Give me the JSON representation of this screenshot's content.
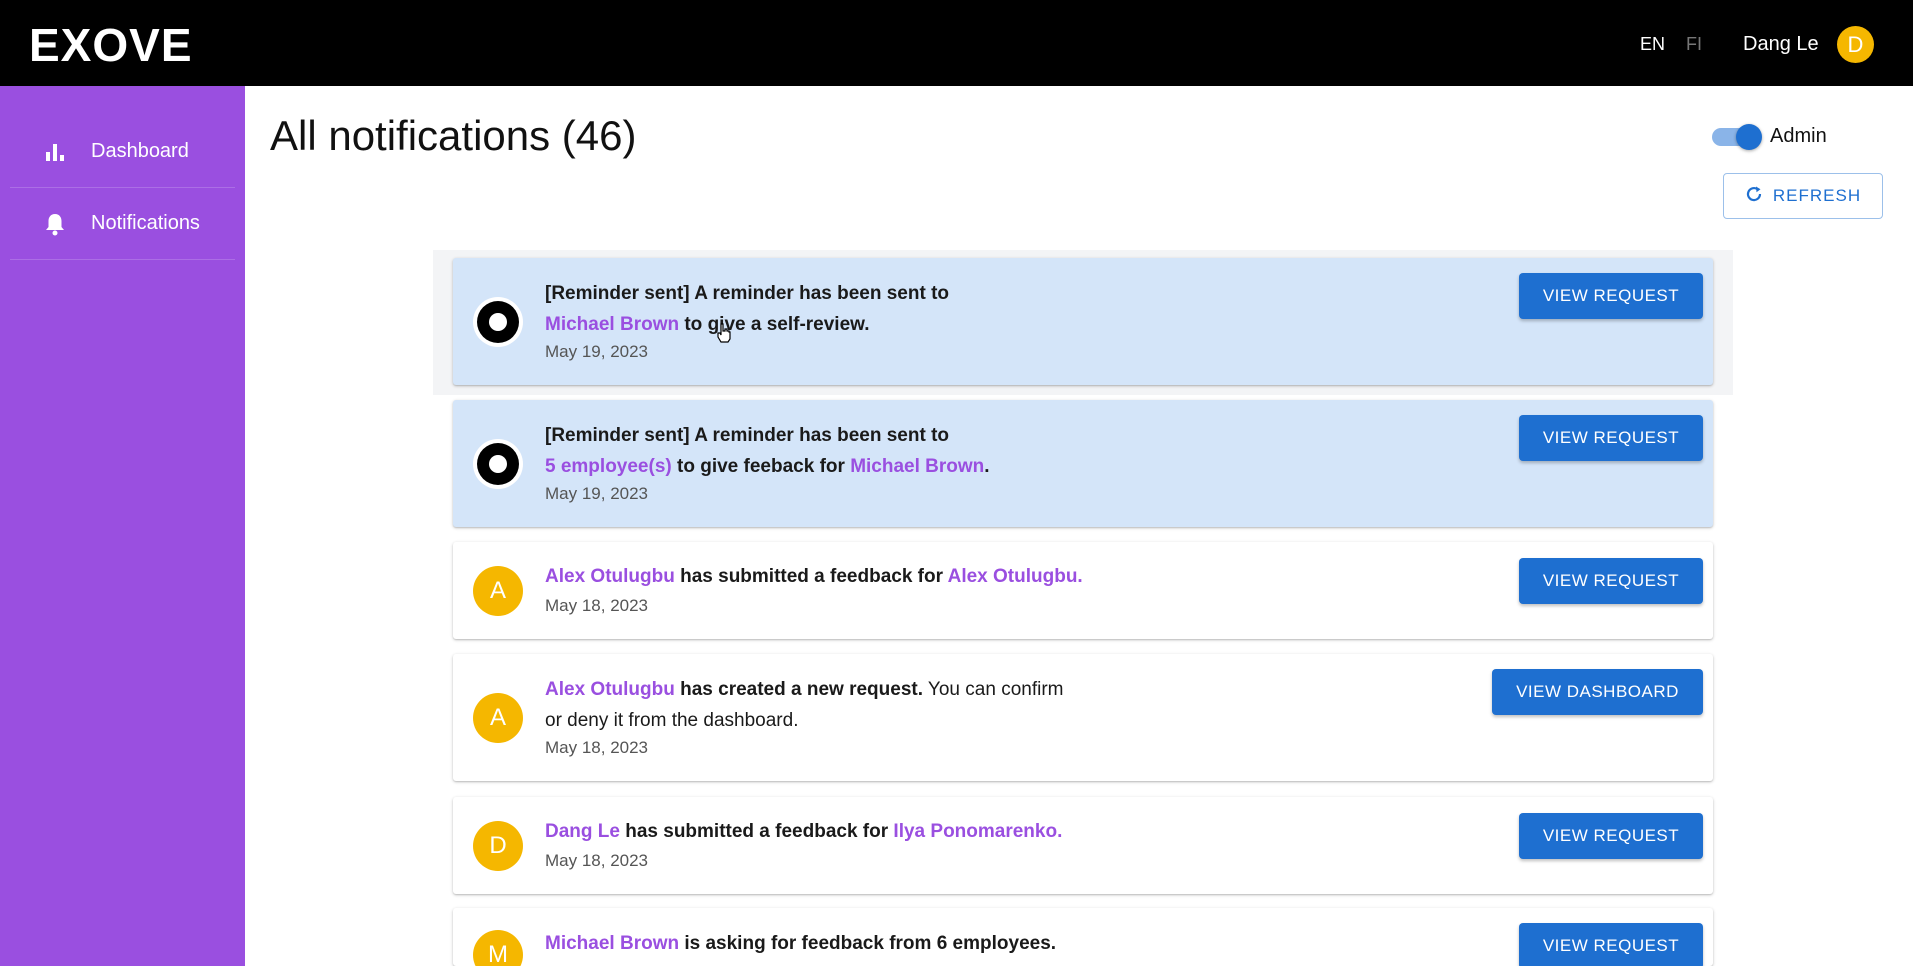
{
  "header": {
    "logo": "EXOVE",
    "lang_en": "EN",
    "lang_fi": "FI",
    "user_name": "Dang Le",
    "user_initial": "D"
  },
  "sidebar": {
    "items": [
      {
        "label": "Dashboard",
        "icon": "bar-chart-icon"
      },
      {
        "label": "Notifications",
        "icon": "bell-icon"
      }
    ]
  },
  "main": {
    "title": "All notifications (46)",
    "admin_label": "Admin",
    "admin_enabled": true,
    "refresh_label": "REFRESH"
  },
  "notifications": [
    {
      "avatar": "ring",
      "line1_prefix": "[Reminder sent] A reminder has been sent to",
      "line2_link": "Michael Brown",
      "line2_suffix": " to give a self-review.",
      "date": "May 19, 2023",
      "action": "VIEW REQUEST"
    },
    {
      "avatar": "ring",
      "line1_prefix": "[Reminder sent] A reminder has been sent to",
      "line2_link": "5 employee(s)",
      "line2_mid": " to give feeback for ",
      "line2_link2": "Michael Brown",
      "line2_suffix": ".",
      "date": "May 19, 2023",
      "action": "VIEW REQUEST"
    },
    {
      "avatar_initial": "A",
      "actor": "Alex Otulugbu",
      "mid": " has submitted a feedback for ",
      "target": "Alex Otulugbu.",
      "date": "May 18, 2023",
      "action": "VIEW REQUEST"
    },
    {
      "avatar_initial": "A",
      "actor": "Alex Otulugbu",
      "mid": " has created a new request.",
      "rest1": " You can confirm",
      "rest2": "or deny it from the dashboard.",
      "date": "May 18, 2023",
      "action": "VIEW DASHBOARD"
    },
    {
      "avatar_initial": "D",
      "actor": "Dang Le",
      "mid": " has submitted a feedback for ",
      "target": "Ilya Ponomarenko.",
      "date": "May 18, 2023",
      "action": "VIEW REQUEST"
    },
    {
      "avatar_initial": "M",
      "actor": "Michael Brown",
      "mid": " is asking for feedback from 6 employees.",
      "action": "VIEW REQUEST"
    }
  ],
  "colors": {
    "sidebar": "#9a4fe0",
    "topbar": "#000000",
    "accent": "#1e6fd0",
    "unread_bg": "#d4e5f9",
    "avatar_yellow": "#f5b700",
    "link_purple": "#9a4fe0"
  }
}
